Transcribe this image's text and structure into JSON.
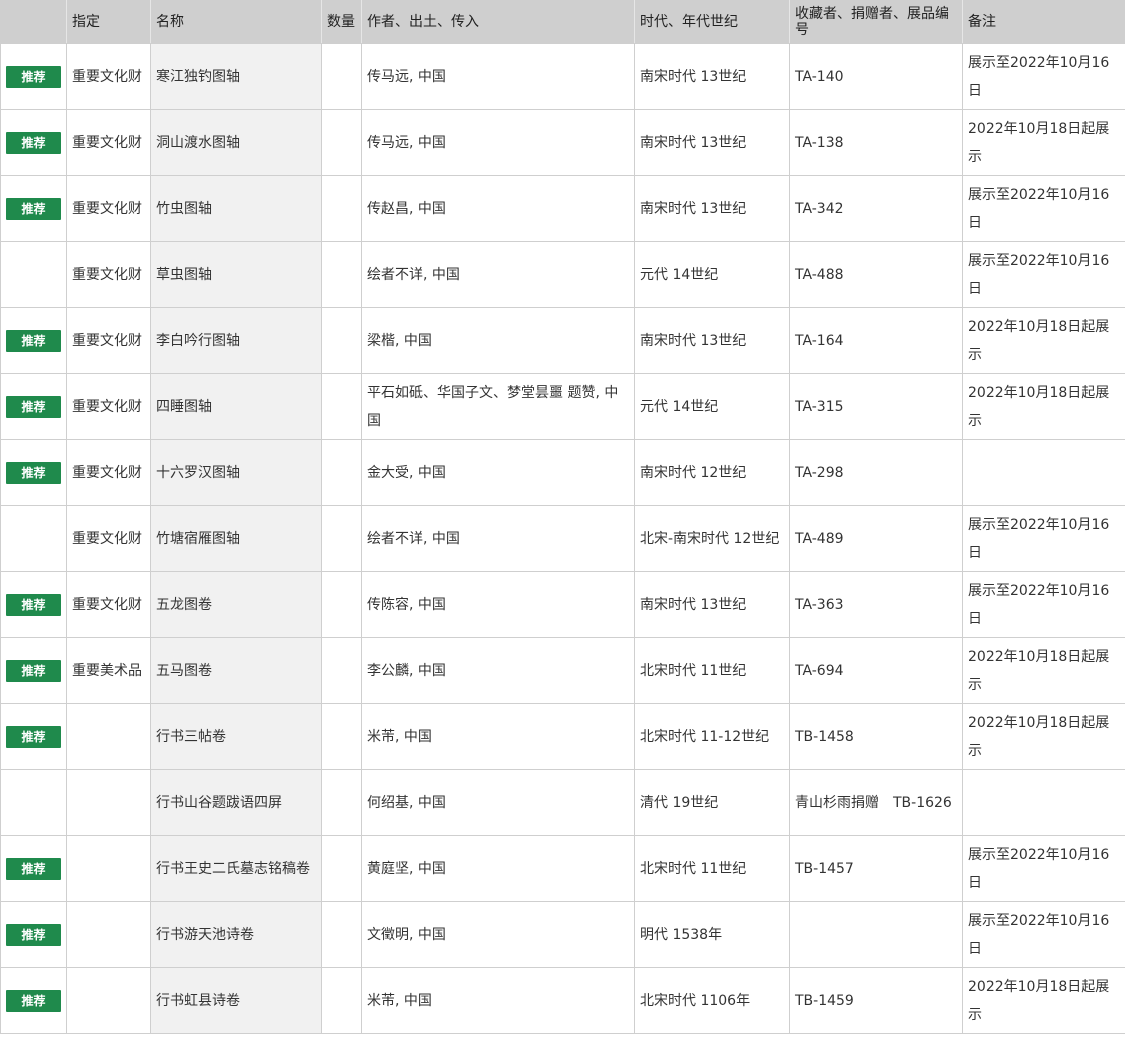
{
  "colors": {
    "badge": "#1f8a4c",
    "header_bg": "#cfcfcf",
    "name_col_bg": "#f1f1f1",
    "border": "#cfcfcf"
  },
  "table": {
    "headers": {
      "designation": "指定",
      "name": "名称",
      "quantity": "数量",
      "author": "作者、出土、传入",
      "period": "时代、年代世纪",
      "collection": "收藏者、捐赠者、展品编号",
      "notes": "备注"
    },
    "rows": [
      {
        "badge": "推荐",
        "designation": "重要文化财",
        "name": "寒江独钓图轴",
        "quantity": "",
        "author": "传马远, 中国",
        "period": "南宋时代 13世纪",
        "collection": "TA-140",
        "notes": "展示至2022年10月16日"
      },
      {
        "badge": "推荐",
        "designation": "重要文化财",
        "name": "洞山渡水图轴",
        "quantity": "",
        "author": "传马远, 中国",
        "period": "南宋时代 13世纪",
        "collection": "TA-138",
        "notes": "2022年10月18日起展示"
      },
      {
        "badge": "推荐",
        "designation": "重要文化财",
        "name": "竹虫图轴",
        "quantity": "",
        "author": "传赵昌, 中国",
        "period": "南宋时代 13世纪",
        "collection": "TA-342",
        "notes": "展示至2022年10月16日"
      },
      {
        "badge": "",
        "designation": "重要文化财",
        "name": "草虫图轴",
        "quantity": "",
        "author": "绘者不详, 中国",
        "period": "元代 14世纪",
        "collection": "TA-488",
        "notes": "展示至2022年10月16日"
      },
      {
        "badge": "推荐",
        "designation": "重要文化财",
        "name": "李白吟行图轴",
        "quantity": "",
        "author": "梁楷, 中国",
        "period": "南宋时代 13世纪",
        "collection": "TA-164",
        "notes": "2022年10月18日起展示"
      },
      {
        "badge": "推荐",
        "designation": "重要文化财",
        "name": "四睡图轴",
        "quantity": "",
        "author": "平石如砥、华国子文、梦堂昙噩 题赞, 中国",
        "period": "元代 14世纪",
        "collection": "TA-315",
        "notes": "2022年10月18日起展示"
      },
      {
        "badge": "推荐",
        "designation": "重要文化财",
        "name": "十六罗汉图轴",
        "quantity": "",
        "author": "金大受, 中国",
        "period": "南宋时代 12世纪",
        "collection": "TA-298",
        "notes": ""
      },
      {
        "badge": "",
        "designation": "重要文化财",
        "name": "竹塘宿雁图轴",
        "quantity": "",
        "author": "绘者不详, 中国",
        "period": "北宋-南宋时代 12世纪",
        "collection": "TA-489",
        "notes": "展示至2022年10月16日"
      },
      {
        "badge": "推荐",
        "designation": "重要文化财",
        "name": "五龙图卷",
        "quantity": "",
        "author": "传陈容, 中国",
        "period": "南宋时代 13世纪",
        "collection": "TA-363",
        "notes": "展示至2022年10月16日"
      },
      {
        "badge": "推荐",
        "designation": "重要美术品",
        "name": "五马图卷",
        "quantity": "",
        "author": "李公麟, 中国",
        "period": "北宋时代 11世纪",
        "collection": "TA-694",
        "notes": "2022年10月18日起展示"
      },
      {
        "badge": "推荐",
        "designation": "",
        "name": "行书三帖卷",
        "quantity": "",
        "author": "米芾, 中国",
        "period": "北宋时代 11-12世纪",
        "collection": "TB-1458",
        "notes": "2022年10月18日起展示"
      },
      {
        "badge": "",
        "designation": "",
        "name": "行书山谷题跋语四屏",
        "quantity": "",
        "author": "何绍基, 中国",
        "period": "清代 19世纪",
        "collection": "青山杉雨捐赠　TB-1626",
        "notes": ""
      },
      {
        "badge": "推荐",
        "designation": "",
        "name": "行书王史二氏墓志铭稿卷",
        "quantity": "",
        "author": "黄庭坚, 中国",
        "period": "北宋时代 11世纪",
        "collection": "TB-1457",
        "notes": "展示至2022年10月16日"
      },
      {
        "badge": "推荐",
        "designation": "",
        "name": "行书游天池诗卷",
        "quantity": "",
        "author": "文徵明, 中国",
        "period": "明代 1538年",
        "collection": "",
        "notes": "展示至2022年10月16日"
      },
      {
        "badge": "推荐",
        "designation": "",
        "name": "行书虹县诗卷",
        "quantity": "",
        "author": "米芾, 中国",
        "period": "北宋时代 1106年",
        "collection": "TB-1459",
        "notes": "2022年10月18日起展示"
      }
    ]
  }
}
